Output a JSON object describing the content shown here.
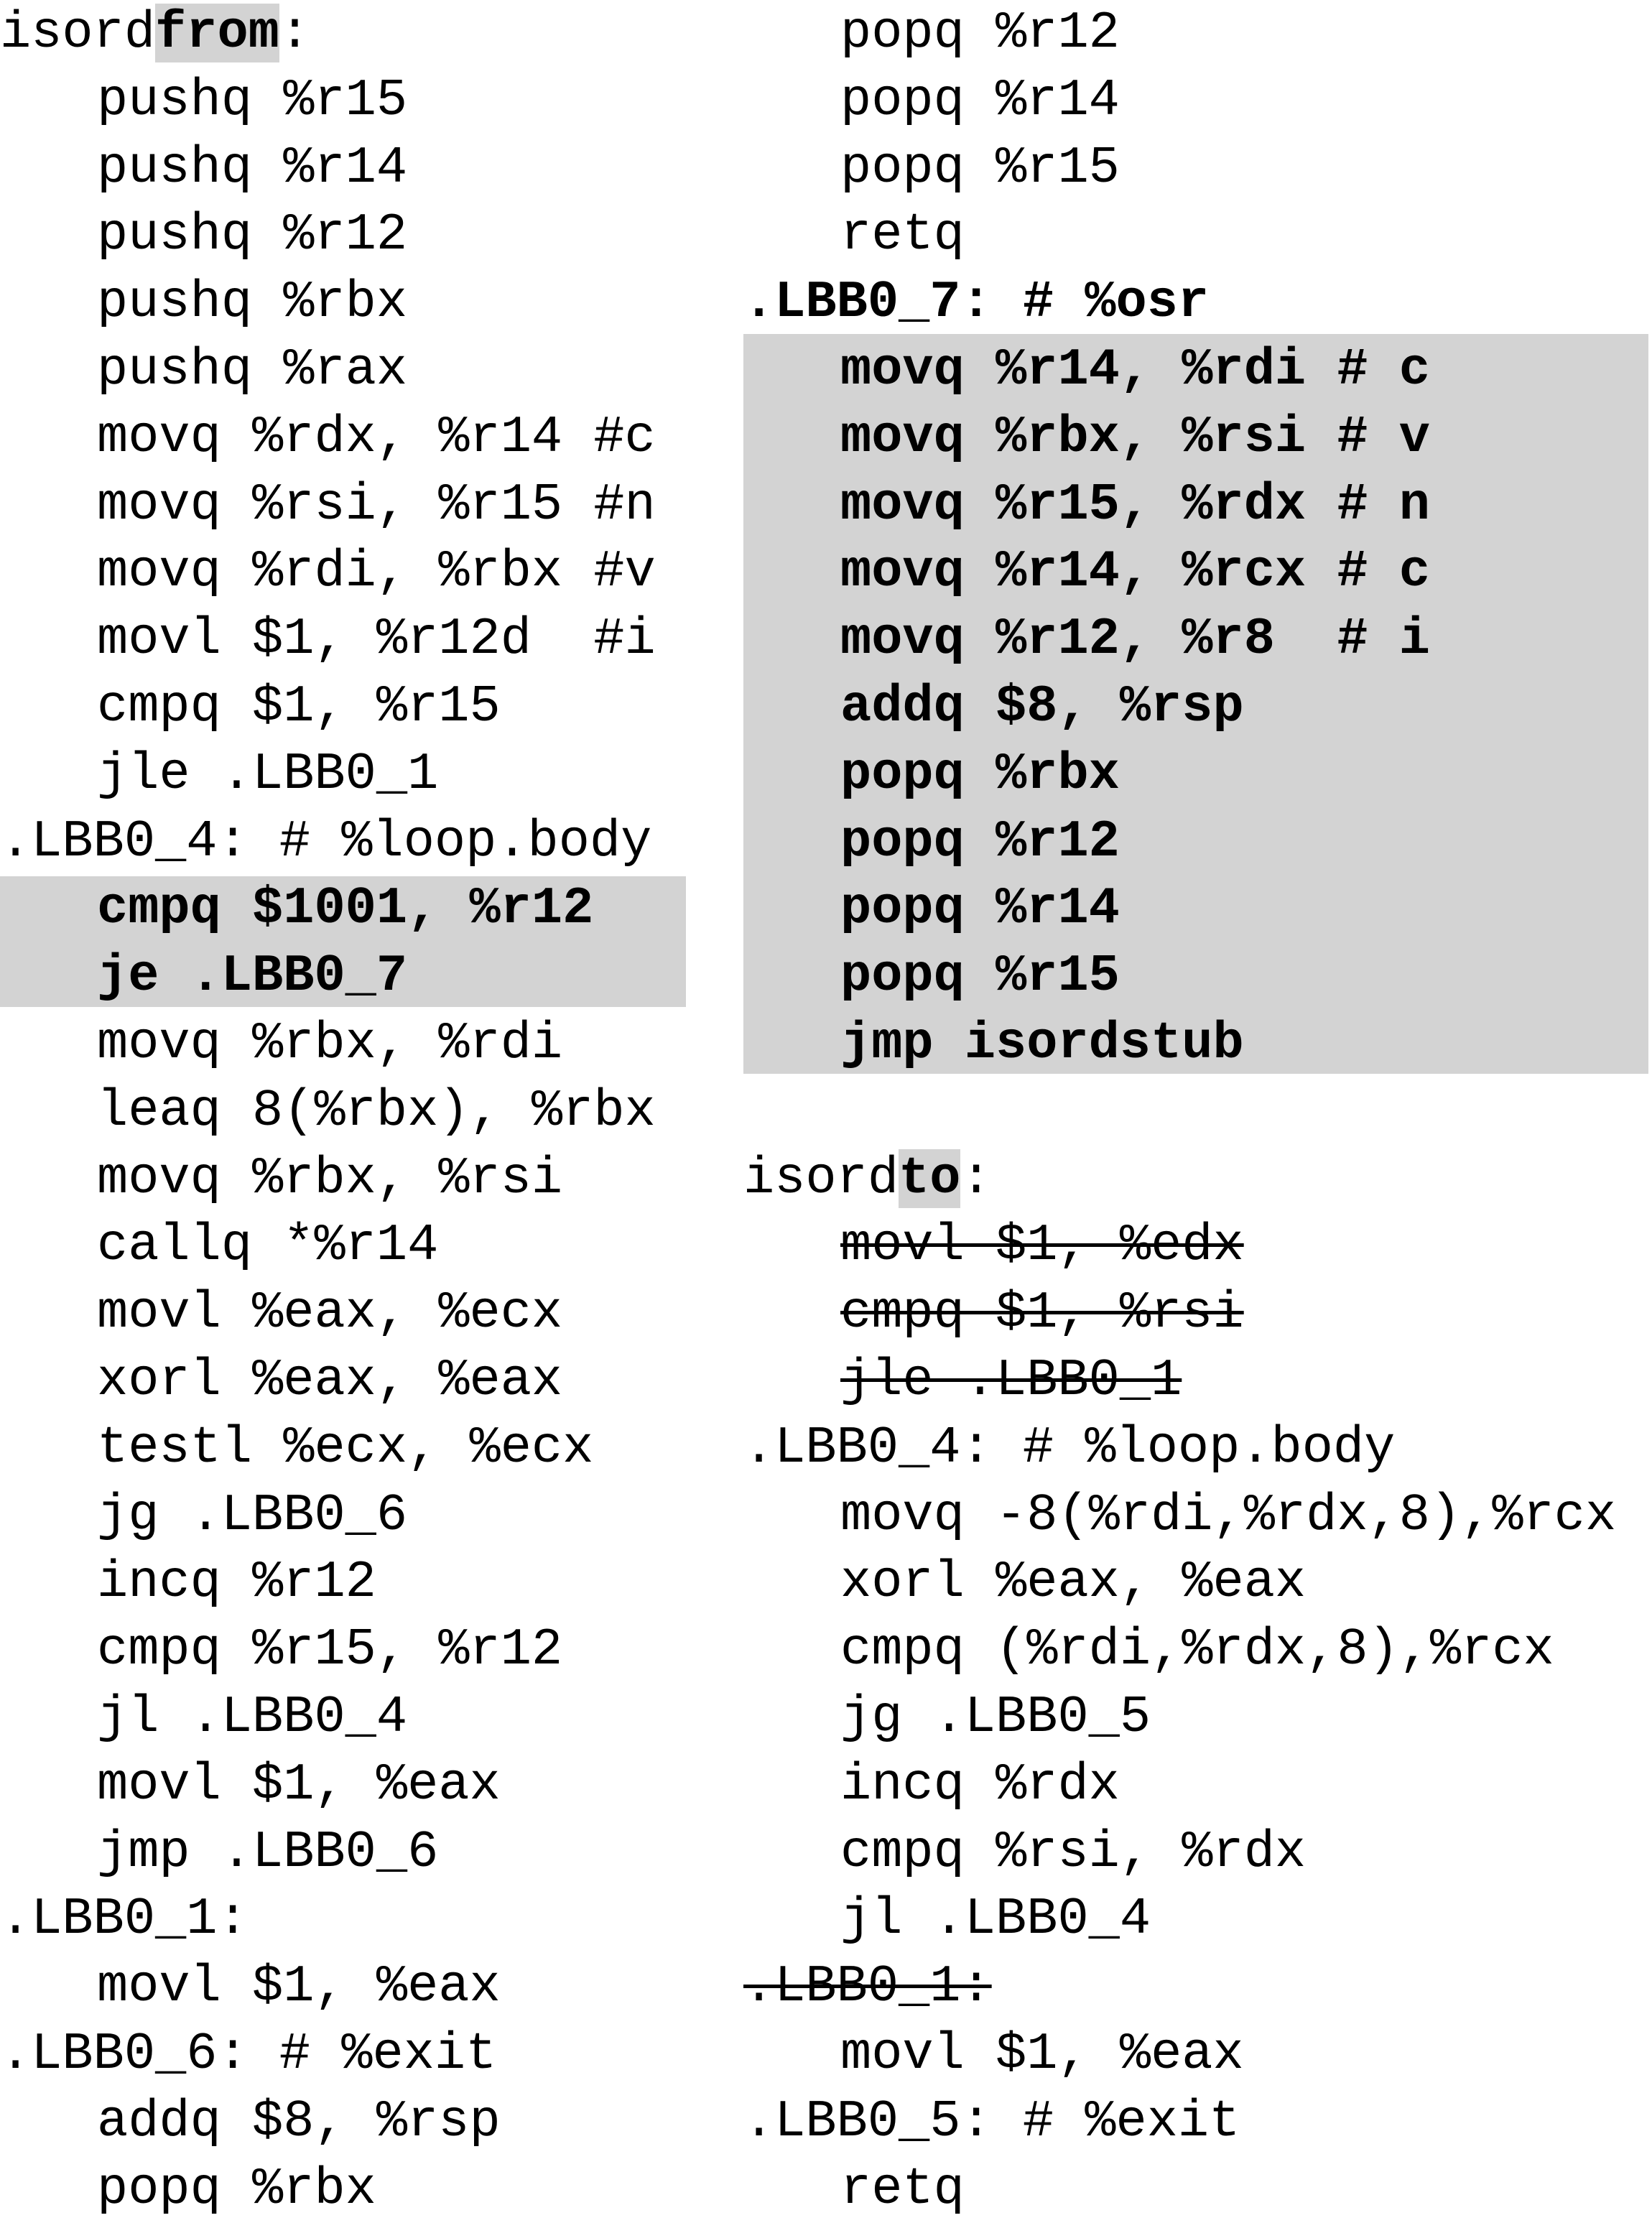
{
  "colors": {
    "highlight": "#d3d3d3",
    "text": "#000000",
    "background": "#ffffff"
  },
  "left": {
    "title_prefix": "isord",
    "title_highlight": "from",
    "title_suffix": ":",
    "lines": [
      {
        "text": "pushq %r15",
        "indent": true
      },
      {
        "text": "pushq %r14",
        "indent": true
      },
      {
        "text": "pushq %r12",
        "indent": true
      },
      {
        "text": "pushq %rbx",
        "indent": true
      },
      {
        "text": "pushq %rax",
        "indent": true
      },
      {
        "text": "movq %rdx, %r14 #c",
        "indent": true
      },
      {
        "text": "movq %rsi, %r15 #n",
        "indent": true
      },
      {
        "text": "movq %rdi, %rbx #v",
        "indent": true
      },
      {
        "text": "movl $1, %r12d  #i",
        "indent": true
      },
      {
        "text": "cmpq $1, %r15",
        "indent": true
      },
      {
        "text": "jle .LBB0_1",
        "indent": true
      },
      {
        "text": ".LBB0_4: # %loop.body",
        "indent": false
      },
      {
        "text": "cmpq $1001, %r12",
        "indent": true,
        "bold": true,
        "highlight": true
      },
      {
        "text": "je .LBB0_7",
        "indent": true,
        "bold": true,
        "highlight": true
      },
      {
        "text": "movq %rbx, %rdi",
        "indent": true
      },
      {
        "text": "leaq 8(%rbx), %rbx",
        "indent": true
      },
      {
        "text": "movq %rbx, %rsi",
        "indent": true
      },
      {
        "text": "callq *%r14",
        "indent": true
      },
      {
        "text": "movl %eax, %ecx",
        "indent": true
      },
      {
        "text": "xorl %eax, %eax",
        "indent": true
      },
      {
        "text": "testl %ecx, %ecx",
        "indent": true
      },
      {
        "text": "jg .LBB0_6",
        "indent": true
      },
      {
        "text": "incq %r12",
        "indent": true
      },
      {
        "text": "cmpq %r15, %r12",
        "indent": true
      },
      {
        "text": "jl .LBB0_4",
        "indent": true
      },
      {
        "text": "movl $1, %eax",
        "indent": true
      },
      {
        "text": "jmp .LBB0_6",
        "indent": true
      },
      {
        "text": ".LBB0_1:",
        "indent": false
      },
      {
        "text": "movl $1, %eax",
        "indent": true
      },
      {
        "text": ".LBB0_6: # %exit",
        "indent": false
      },
      {
        "text": "addq $8, %rsp",
        "indent": true
      },
      {
        "text": "popq %rbx",
        "indent": true
      }
    ]
  },
  "right": {
    "lines_top": [
      {
        "text": "popq %r12",
        "indent": true
      },
      {
        "text": "popq %r14",
        "indent": true
      },
      {
        "text": "popq %r15",
        "indent": true
      },
      {
        "text": "retq",
        "indent": true
      },
      {
        "text": ".LBB0_7: # %osr",
        "indent": false,
        "bold": true
      },
      {
        "text": "movq %r14, %rdi # c",
        "indent": true,
        "bold": true,
        "highlight": true
      },
      {
        "text": "movq %rbx, %rsi # v",
        "indent": true,
        "bold": true,
        "highlight": true
      },
      {
        "text": "movq %r15, %rdx # n",
        "indent": true,
        "bold": true,
        "highlight": true
      },
      {
        "text": "movq %r14, %rcx # c",
        "indent": true,
        "bold": true,
        "highlight": true
      },
      {
        "text": "movq %r12, %r8  # i",
        "indent": true,
        "bold": true,
        "highlight": true
      },
      {
        "text": "addq $8, %rsp",
        "indent": true,
        "bold": true,
        "highlight": true
      },
      {
        "text": "popq %rbx",
        "indent": true,
        "bold": true,
        "highlight": true
      },
      {
        "text": "popq %r12",
        "indent": true,
        "bold": true,
        "highlight": true
      },
      {
        "text": "popq %r14",
        "indent": true,
        "bold": true,
        "highlight": true
      },
      {
        "text": "popq %r15",
        "indent": true,
        "bold": true,
        "highlight": true
      },
      {
        "text": "jmp isordstub",
        "indent": true,
        "bold": true,
        "highlight": true
      },
      {
        "text": "",
        "indent": false
      }
    ],
    "title_prefix": "isord",
    "title_highlight": "to",
    "title_suffix": ":",
    "lines_bottom": [
      {
        "text": "movl $1, %edx",
        "indent": true,
        "struck": true
      },
      {
        "text": "cmpq $1, %rsi",
        "indent": true,
        "struck": true
      },
      {
        "text": "jle .LBB0_1",
        "indent": true,
        "struck": true
      },
      {
        "text": ".LBB0_4: # %loop.body",
        "indent": false
      },
      {
        "text": "movq -8(%rdi,%rdx,8),%rcx",
        "indent": true
      },
      {
        "text": "xorl %eax, %eax",
        "indent": true
      },
      {
        "text": "cmpq (%rdi,%rdx,8),%rcx",
        "indent": true
      },
      {
        "text": "jg .LBB0_5",
        "indent": true
      },
      {
        "text": "incq %rdx",
        "indent": true
      },
      {
        "text": "cmpq %rsi, %rdx",
        "indent": true
      },
      {
        "text": "jl .LBB0_4",
        "indent": true
      },
      {
        "text": ".LBB0_1:",
        "indent": false,
        "struck": true
      },
      {
        "text": "movl $1, %eax",
        "indent": true
      },
      {
        "text": ".LBB0_5: # %exit",
        "indent": false
      },
      {
        "text": "retq",
        "indent": true
      }
    ]
  }
}
